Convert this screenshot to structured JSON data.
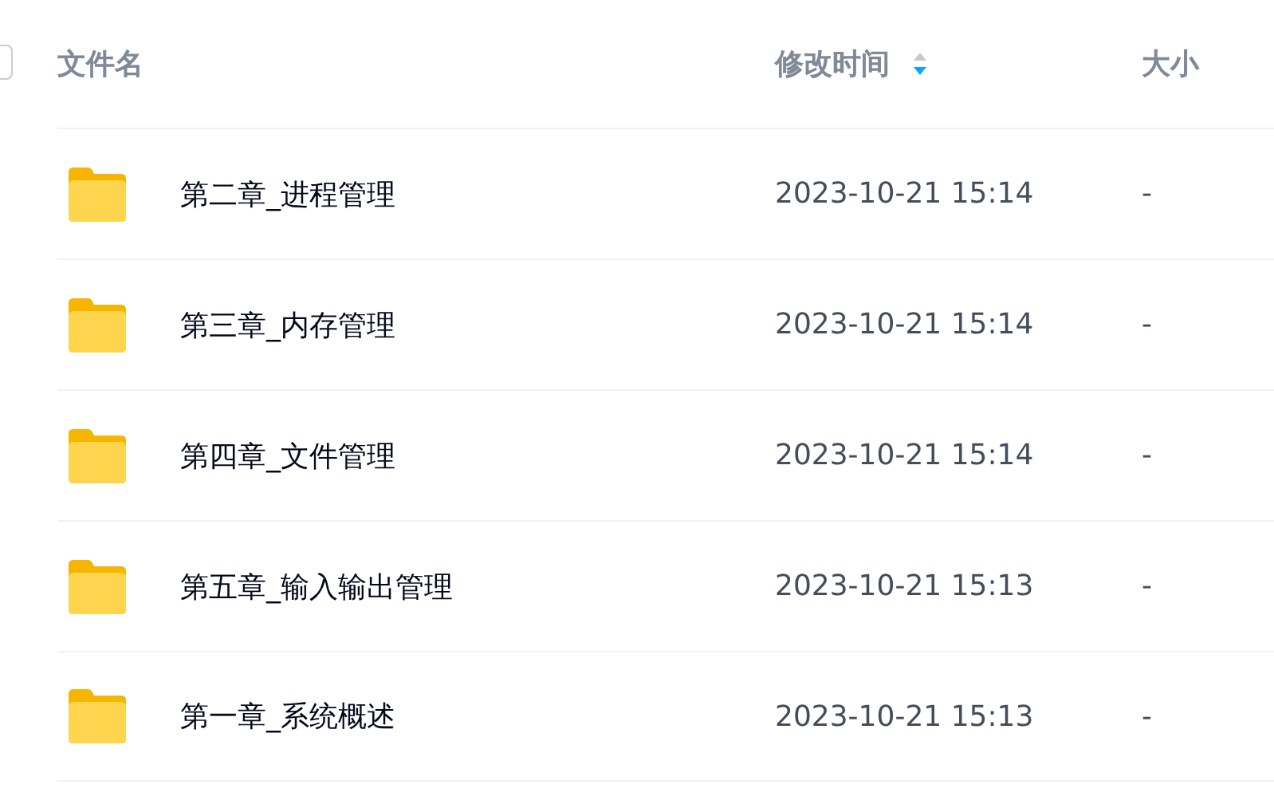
{
  "header": {
    "select_all": {
      "checked": false
    },
    "columns": [
      {
        "label": "文件名"
      },
      {
        "label": "修改时间",
        "sort_descending": true
      },
      {
        "label": "大小"
      }
    ]
  },
  "rows": [
    {
      "name": "第二章_进程管理",
      "modified": "2023-10-21 15:14",
      "size": "-"
    },
    {
      "name": "第三章_内存管理",
      "modified": "2023-10-21 15:14",
      "size": "-"
    },
    {
      "name": "第四章_文件管理",
      "modified": "2023-10-21 15:14",
      "size": "-"
    },
    {
      "name": "第五章_输入输出管理",
      "modified": "2023-10-21 15:13",
      "size": "-"
    },
    {
      "name": "第一章_系统概述",
      "modified": "2023-10-21 15:13",
      "size": "-"
    }
  ]
}
